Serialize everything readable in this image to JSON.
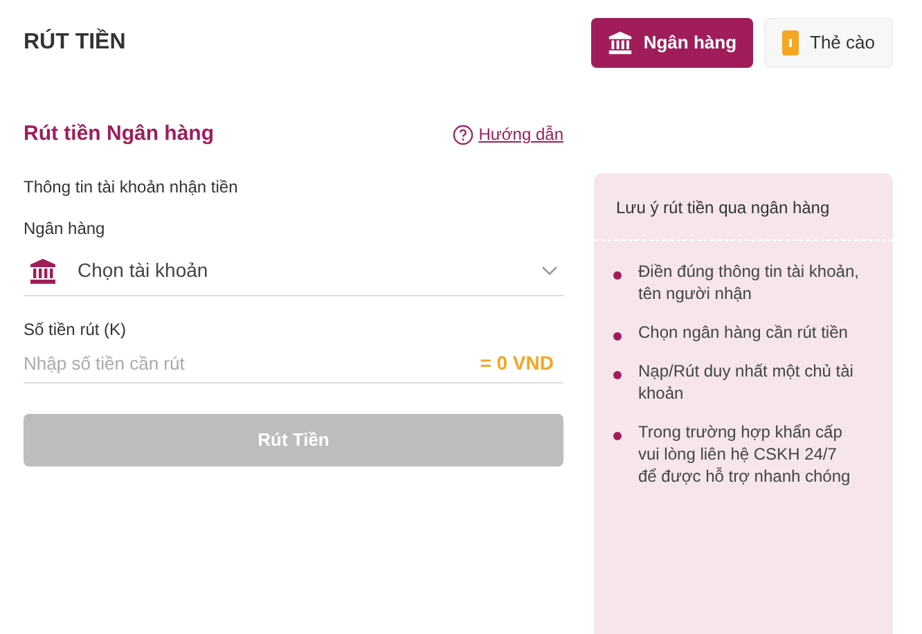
{
  "page_title": "RÚT TIỀN",
  "tabs": [
    {
      "label": "Ngân hàng",
      "kind": "bank",
      "selected": true
    },
    {
      "label": "Thẻ cào",
      "kind": "card",
      "selected": false
    }
  ],
  "section": {
    "title": "Rút tiền Ngân hàng",
    "guide_link": "Hướng dẫn"
  },
  "form": {
    "subtitle": "Thông tin tài khoản nhận tiền",
    "bank_label": "Ngân hàng",
    "bank_select": "Chọn tài khoản",
    "amount_label": "Số tiền rút (K)",
    "amount_placeholder": "Nhập số tiền cần rút",
    "amount_converted": "= 0 VND",
    "submit": {
      "label": "Rút Tiền",
      "disabled": true
    }
  },
  "notes": {
    "title": "Lưu ý rút tiền qua ngân hàng",
    "items": [
      "Điền đúng thông tin tài khoản, tên người nhận",
      "Chọn ngân hàng cần rút tiền",
      "Nạp/Rút duy nhất một chủ tài khoản",
      "Trong trường hợp khẩn cấp vui lòng liên hệ CSKH 24/7 để được hỗ trợ nhanh chóng"
    ]
  }
}
